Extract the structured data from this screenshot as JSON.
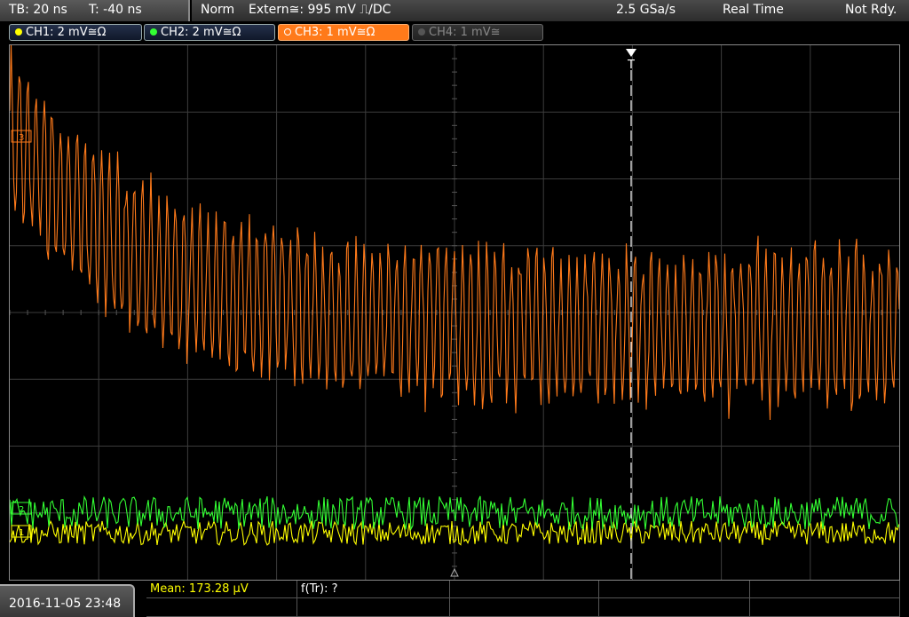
{
  "header": {
    "timebase": "TB: 20 ns",
    "trigger_offset": "T: -40 ns",
    "acq_mode": "Norm",
    "trigger_source": "Extern≅: 995 mV ⎍/DC",
    "sample_rate": "2.5 GSa/s",
    "mode": "Real Time",
    "status": "Not Rdy."
  },
  "channels": [
    {
      "label": "CH1: 2 mV≅Ω",
      "color": "#ffff00",
      "state": "on"
    },
    {
      "label": "CH2: 2 mV≅Ω",
      "color": "#33ff33",
      "state": "on"
    },
    {
      "label": "CH3: 1 mV≅Ω",
      "color": "#ff7a1a",
      "state": "active"
    },
    {
      "label": "CH4: 1 mV≅",
      "color": "#888888",
      "state": "off"
    }
  ],
  "markers": {
    "trigger": "T",
    "ch3_ref": "3",
    "ch2_ref": "2",
    "ch1_ref": "1"
  },
  "footer": {
    "datetime": "2016-11-05 23:48",
    "mean_label": "Mean: 173.28 µV",
    "ftr_label": "f(Tr): ?"
  },
  "colors": {
    "ch1": "#ffff00",
    "ch2": "#33ff33",
    "ch3": "#ff7a1a",
    "grid": "#3c3c3c",
    "trigger_line": "#ffffff"
  },
  "chart_data": {
    "type": "line",
    "x_divisions": 10,
    "y_divisions": 8,
    "series": [
      {
        "name": "CH3",
        "description_levels": {
          "start_offset_div": 2.7,
          "settle_offset_div": -0.2,
          "amplitude_div": 1.0
        }
      },
      {
        "name": "CH2",
        "description_levels": {
          "offset_div": -3.0,
          "amplitude_div": 0.25
        }
      },
      {
        "name": "CH1",
        "description_levels": {
          "offset_div": -3.3,
          "amplitude_div": 0.18
        }
      }
    ]
  }
}
